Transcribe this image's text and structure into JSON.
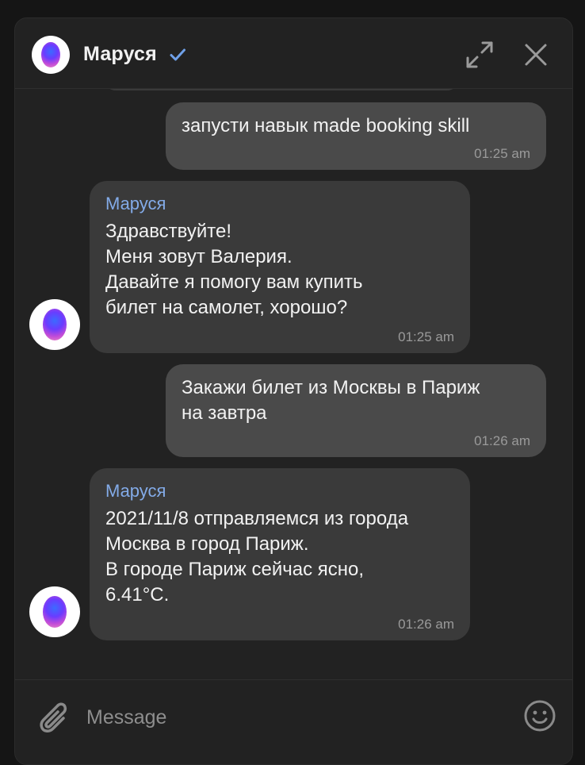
{
  "header": {
    "title": "Маруся",
    "verified_icon": "check-icon",
    "expand_icon": "expand-icon",
    "close_icon": "close-icon"
  },
  "messages": [
    {
      "direction": "outgoing",
      "lines": [
        "запусти навык made booking skill"
      ],
      "time": "01:25 am"
    },
    {
      "direction": "incoming",
      "sender": "Маруся",
      "lines": [
        "Здравствуйте!",
        "Меня зовут Валерия.",
        "Давайте я помогу вам купить",
        "билет на самолет, хорошо?"
      ],
      "time": "01:25 am"
    },
    {
      "direction": "outgoing",
      "lines": [
        "Закажи билет из Москвы в Париж",
        "на завтра"
      ],
      "time": "01:26 am"
    },
    {
      "direction": "incoming",
      "sender": "Маруся",
      "lines": [
        "2021/11/8 отправляемся из города",
        "Москва в город Париж.",
        "В городе Париж сейчас ясно,",
        "6.41°C."
      ],
      "time": "01:26 am"
    }
  ],
  "composer": {
    "placeholder": "Message",
    "value": "",
    "attach_icon": "paperclip-icon",
    "emoji_icon": "smiley-icon"
  },
  "colors": {
    "background": "#222222",
    "outgoing_bubble": "#4a4a4a",
    "incoming_bubble": "#3a3a3a",
    "sender_name": "#83abe8",
    "verified": "#6fa0e8"
  }
}
